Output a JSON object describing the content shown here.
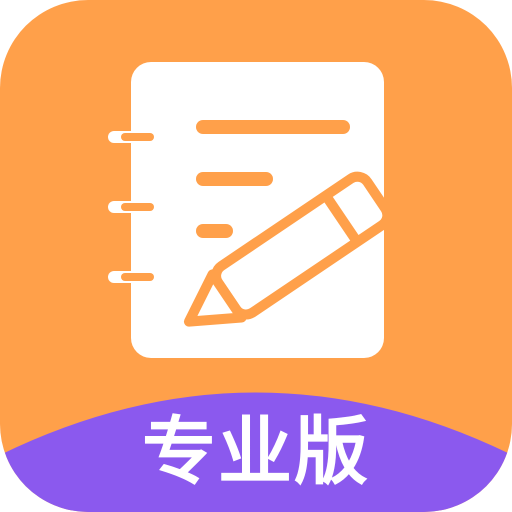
{
  "app_icon": {
    "icon": "notebook-with-pencil-icon",
    "badge_label": "专业版",
    "colors": {
      "background": "#FFA04A",
      "badge": "#8B59EE",
      "notebook": "#FFFFFF",
      "line": "#FFA04A",
      "badge_text": "#FFFFFF"
    }
  }
}
